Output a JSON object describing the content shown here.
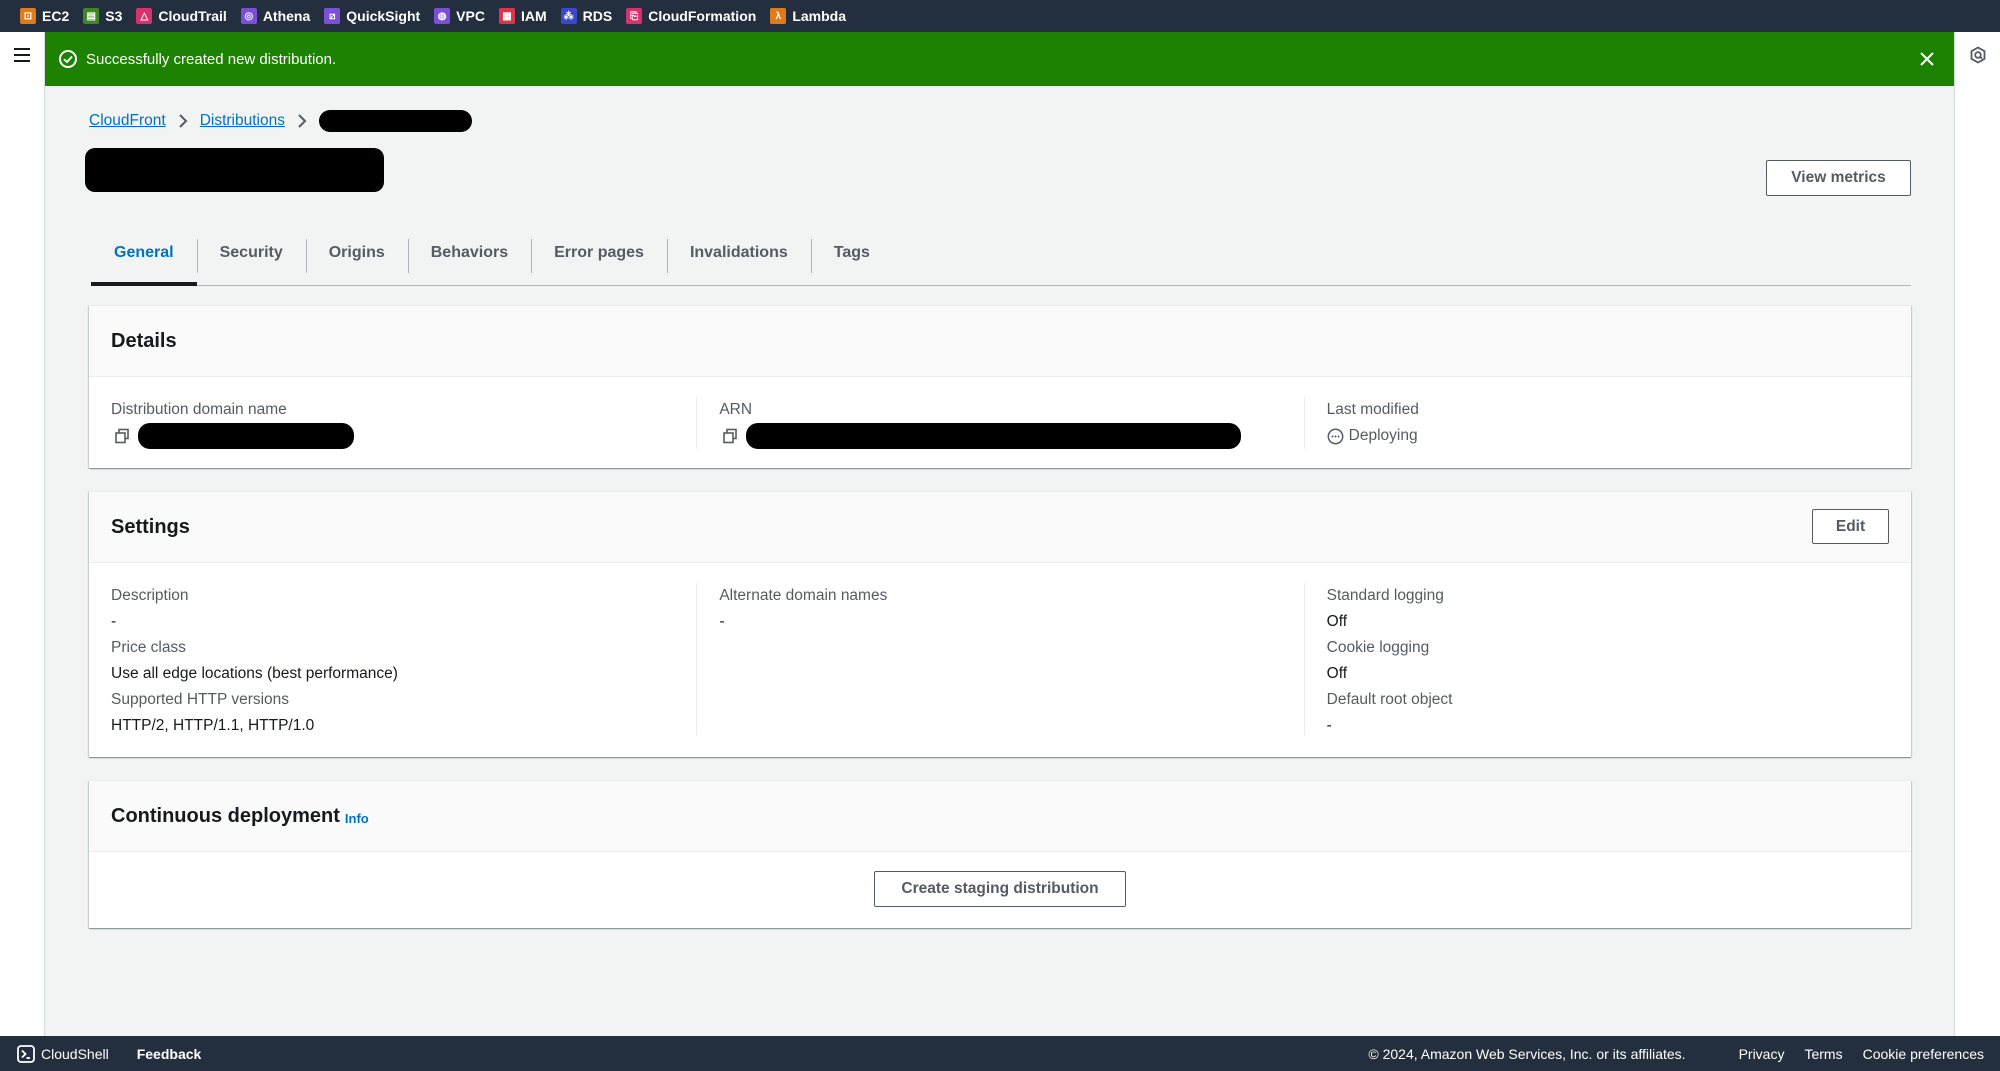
{
  "services_bar": {
    "items": [
      {
        "label": "EC2",
        "color": "#e07b1a",
        "glyph": "⊡"
      },
      {
        "label": "S3",
        "color": "#3f8624",
        "glyph": "▤"
      },
      {
        "label": "CloudTrail",
        "color": "#d6336c",
        "glyph": "△"
      },
      {
        "label": "Athena",
        "color": "#7b4fd6",
        "glyph": "◎"
      },
      {
        "label": "QuickSight",
        "color": "#7b4fd6",
        "glyph": "⧄"
      },
      {
        "label": "VPC",
        "color": "#7b4fd6",
        "glyph": "◍"
      },
      {
        "label": "IAM",
        "color": "#dd344c",
        "glyph": "▦"
      },
      {
        "label": "RDS",
        "color": "#3b48cc",
        "glyph": "⁂"
      },
      {
        "label": "CloudFormation",
        "color": "#d6336c",
        "glyph": "⎘"
      },
      {
        "label": "Lambda",
        "color": "#e07b1a",
        "glyph": "λ"
      }
    ]
  },
  "flash": {
    "message": "Successfully created new distribution.",
    "type": "success",
    "color": "#1d8102"
  },
  "breadcrumb": {
    "items": [
      {
        "label": "CloudFront"
      },
      {
        "label": "Distributions"
      }
    ],
    "current_redacted": true
  },
  "page": {
    "title_redacted": true,
    "view_metrics_label": "View metrics"
  },
  "tabs": [
    {
      "label": "General",
      "active": true
    },
    {
      "label": "Security",
      "active": false
    },
    {
      "label": "Origins",
      "active": false
    },
    {
      "label": "Behaviors",
      "active": false
    },
    {
      "label": "Error pages",
      "active": false
    },
    {
      "label": "Invalidations",
      "active": false
    },
    {
      "label": "Tags",
      "active": false
    }
  ],
  "details": {
    "title": "Details",
    "domain_name_label": "Distribution domain name",
    "arn_label": "ARN",
    "last_modified_label": "Last modified",
    "last_modified_value": "Deploying"
  },
  "settings": {
    "title": "Settings",
    "edit_label": "Edit",
    "description_label": "Description",
    "description_value": "-",
    "price_class_label": "Price class",
    "price_class_value": "Use all edge locations (best performance)",
    "http_versions_label": "Supported HTTP versions",
    "http_versions_value": "HTTP/2, HTTP/1.1, HTTP/1.0",
    "alt_domains_label": "Alternate domain names",
    "alt_domains_value": "-",
    "standard_logging_label": "Standard logging",
    "standard_logging_value": "Off",
    "cookie_logging_label": "Cookie logging",
    "cookie_logging_value": "Off",
    "default_root_label": "Default root object",
    "default_root_value": "-"
  },
  "continuous_deployment": {
    "title": "Continuous deployment",
    "info_label": "Info",
    "create_staging_label": "Create staging distribution"
  },
  "footer": {
    "cloudshell_label": "CloudShell",
    "feedback_label": "Feedback",
    "copyright": "© 2024, Amazon Web Services, Inc. or its affiliates.",
    "privacy_label": "Privacy",
    "terms_label": "Terms",
    "cookie_label": "Cookie preferences"
  }
}
